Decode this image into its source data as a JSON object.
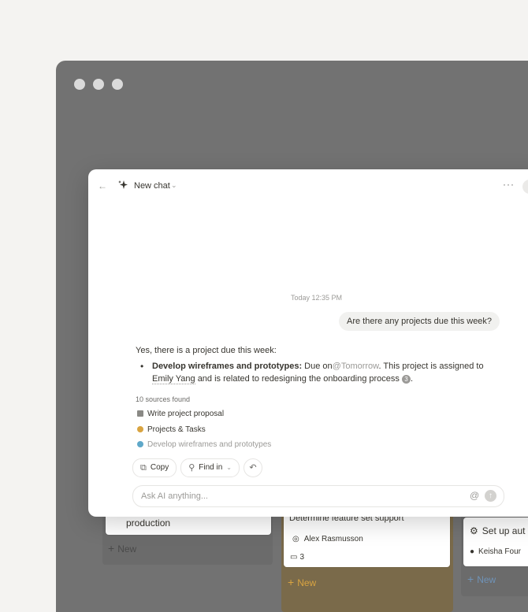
{
  "chat": {
    "title": "New chat",
    "timestamp": "Today 12:35 PM",
    "user_message": "Are there any projects due this week?",
    "answer": {
      "intro": "Yes, there is a project due this week:",
      "item_title": "Develop wireframes and prototypes:",
      "due_prefix": "Due on",
      "due_mention": "@Tomorrow",
      "assigned_prefix": ". This project is assigned to",
      "assignee": "Emily Yang",
      "related_text": "and is related to redesigning the onboarding process",
      "citation": "3",
      "end": "."
    },
    "sources_count": "10 sources found",
    "sources": [
      {
        "label": "Write project proposal",
        "icon": "document-icon",
        "color": "#8a8985"
      },
      {
        "label": "Projects & Tasks",
        "icon": "check-circle-icon",
        "color": "#d9a441"
      },
      {
        "label": "Develop wireframes and prototypes",
        "icon": "globe-icon",
        "color": "#5fa8c9"
      }
    ],
    "actions": {
      "copy": "Copy",
      "find_in": "Find in"
    },
    "input": {
      "placeholder": "Ask AI anything..."
    }
  },
  "board": {
    "col1_card": "production",
    "col1_new": "New",
    "col2_card_title": "Determine feature set support",
    "col2_assignee": "Alex Rasmusson",
    "col2_comments": "3",
    "col2_new": "New",
    "col3_card_title": "Set up aut",
    "col3_assignee": "Keisha Four",
    "col3_new": "New"
  },
  "colors": {
    "background": "#f4f3f1",
    "window": "#727272",
    "accent_orange": "#d9a441"
  }
}
